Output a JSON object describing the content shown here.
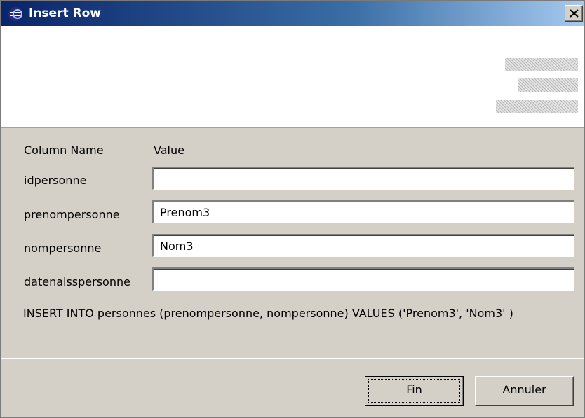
{
  "window": {
    "title": "Insert Row"
  },
  "header": {
    "column_name": "Column Name",
    "value": "Value"
  },
  "rows": [
    {
      "label": "idpersonne",
      "value": ""
    },
    {
      "label": "prenompersonne",
      "value": "Prenom3"
    },
    {
      "label": "nompersonne",
      "value": "Nom3"
    },
    {
      "label": "datenaisspersonne",
      "value": ""
    }
  ],
  "sql": "INSERT INTO personnes (prenompersonne, nompersonne) VALUES ('Prenom3', 'Nom3' )",
  "buttons": {
    "finish": "Fin",
    "cancel": "Annuler"
  },
  "icons": {
    "title": "app-icon",
    "close": "close-icon"
  }
}
